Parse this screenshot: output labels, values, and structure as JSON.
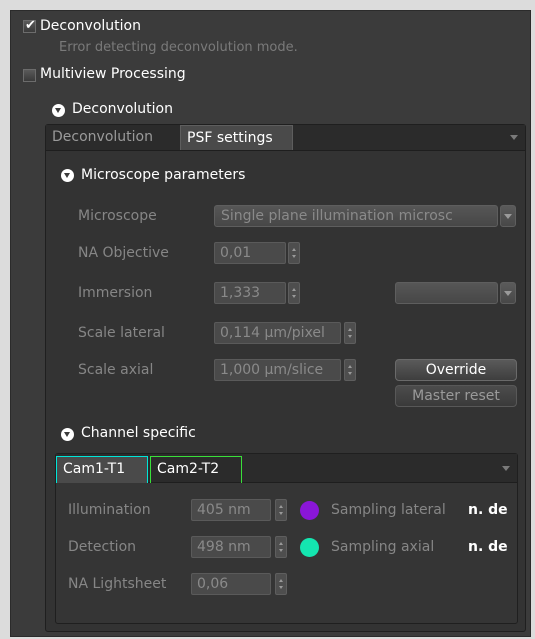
{
  "deconvolution_checkbox": {
    "label": "Deconvolution",
    "checked": true
  },
  "error_message": "Error detecting deconvolution mode.",
  "multiview_checkbox": {
    "label": "Multiview Processing",
    "checked": false
  },
  "section_header": "Deconvolution",
  "main_tabs": [
    {
      "label": "Deconvolution",
      "active": false
    },
    {
      "label": "PSF settings",
      "active": true
    }
  ],
  "microscope_parameters": {
    "header": "Microscope parameters",
    "microscope_label": "Microscope",
    "microscope_value": "Single plane illumination microsc",
    "na_objective_label": "NA Objective",
    "na_objective_value": "0,01",
    "immersion_label": "Immersion",
    "immersion_value": "1,333",
    "immersion_medium_value": "",
    "scale_lateral_label": "Scale lateral",
    "scale_lateral_value": "0,114 µm/pixel",
    "scale_axial_label": "Scale axial",
    "scale_axial_value": "1,000 µm/slice",
    "override_button": "Override",
    "master_reset_button": "Master reset"
  },
  "channel_specific": {
    "header": "Channel specific",
    "tabs": [
      {
        "label": "Cam1-T1",
        "active": true,
        "color": "#00e5d8"
      },
      {
        "label": "Cam2-T2",
        "active": false,
        "color": "#3adf3a"
      }
    ],
    "illumination_label": "Illumination",
    "illumination_value": "405 nm",
    "illumination_color": "#8a16d8",
    "detection_label": "Detection",
    "detection_value": "498 nm",
    "detection_color": "#14e6b0",
    "na_lightsheet_label": "NA Lightsheet",
    "na_lightsheet_value": "0,06",
    "sampling_lateral_label": "Sampling lateral",
    "sampling_lateral_value": "n. de",
    "sampling_axial_label": "Sampling axial",
    "sampling_axial_value": "n. de"
  },
  "colors": {
    "panel_bg": "#3b3b3b",
    "active_tab": "#4a4a4a",
    "dim_text": "#868686"
  }
}
